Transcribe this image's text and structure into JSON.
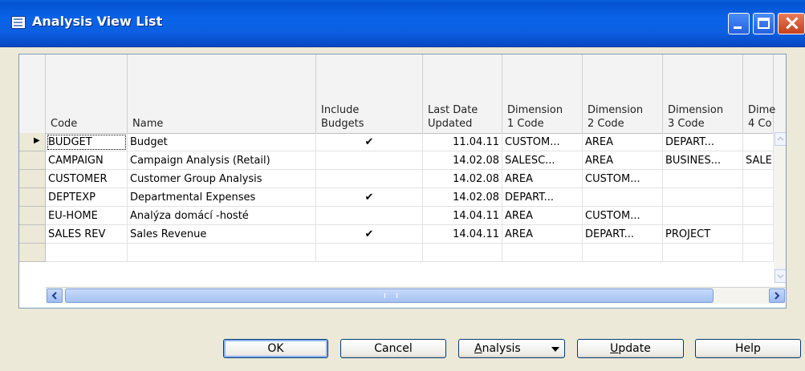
{
  "window": {
    "title": "Analysis View List"
  },
  "columns": [
    {
      "key": "code",
      "label": "Code"
    },
    {
      "key": "name",
      "label": "Name"
    },
    {
      "key": "include_budgets",
      "label": "Include\nBudgets"
    },
    {
      "key": "last_date_updated",
      "label": "Last Date\nUpdated"
    },
    {
      "key": "dim1",
      "label": "Dimension\n1 Code"
    },
    {
      "key": "dim2",
      "label": "Dimension\n2 Code"
    },
    {
      "key": "dim3",
      "label": "Dimension\n3 Code"
    },
    {
      "key": "dim4",
      "label": "Dime\n4 Co"
    }
  ],
  "rows": [
    {
      "code": "BUDGET",
      "name": "Budget",
      "include_budgets": "✔",
      "last_date_updated": "11.04.11",
      "dim1": "CUSTOM...",
      "dim2": "AREA",
      "dim3": "DEPART...",
      "dim4": ""
    },
    {
      "code": "CAMPAIGN",
      "name": "Campaign Analysis (Retail)",
      "include_budgets": "",
      "last_date_updated": "14.02.08",
      "dim1": "SALESC...",
      "dim2": "AREA",
      "dim3": "BUSINES...",
      "dim4": "SALE"
    },
    {
      "code": "CUSTOMER",
      "name": "Customer Group Analysis",
      "include_budgets": "",
      "last_date_updated": "14.02.08",
      "dim1": "AREA",
      "dim2": "CUSTOM...",
      "dim3": "",
      "dim4": ""
    },
    {
      "code": "DEPTEXP",
      "name": "Departmental Expenses",
      "include_budgets": "✔",
      "last_date_updated": "14.02.08",
      "dim1": "DEPART...",
      "dim2": "",
      "dim3": "",
      "dim4": ""
    },
    {
      "code": "EU-HOME",
      "name": "Analýza domácí -hosté",
      "include_budgets": "",
      "last_date_updated": "14.04.11",
      "dim1": "AREA",
      "dim2": "CUSTOM...",
      "dim3": "",
      "dim4": ""
    },
    {
      "code": "SALES REV",
      "name": "Sales Revenue",
      "include_budgets": "✔",
      "last_date_updated": "14.04.11",
      "dim1": "AREA",
      "dim2": "DEPART...",
      "dim3": "PROJECT",
      "dim4": ""
    },
    {
      "code": "",
      "name": "",
      "include_budgets": "",
      "last_date_updated": "",
      "dim1": "",
      "dim2": "",
      "dim3": "",
      "dim4": ""
    }
  ],
  "current_row_indicator": "▶",
  "buttons": {
    "ok": "OK",
    "cancel": "Cancel",
    "analysis_underlined": "A",
    "analysis_rest": "nalysis",
    "update_underlined": "U",
    "update_rest": "pdate",
    "help": "Help"
  },
  "icons": {
    "app": "list-window-icon",
    "minimize": "minimize-icon",
    "maximize": "maximize-icon",
    "close": "close-icon",
    "scroll_left": "arrow-left-icon",
    "scroll_right": "arrow-right-icon",
    "scroll_up": "arrow-up-icon",
    "scroll_down": "arrow-down-icon",
    "dropdown": "chevron-down-icon"
  },
  "colors": {
    "titlebar": "#0a5fd8",
    "window_bg": "#ece9d8",
    "close_button": "#c8401c"
  }
}
